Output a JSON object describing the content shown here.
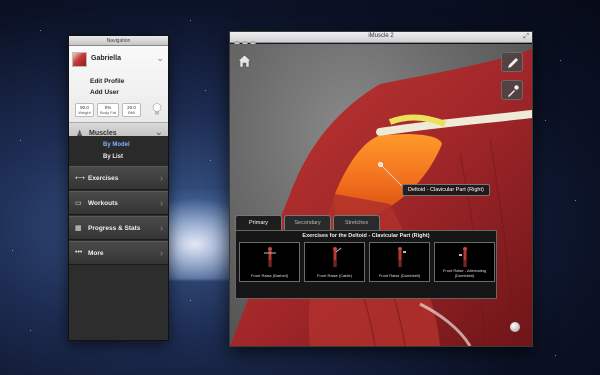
{
  "navigation": {
    "title": "Navigation",
    "user": {
      "name": "Gabriella",
      "edit_profile": "Edit Profile",
      "add_user": "Add User",
      "stats": [
        {
          "value": "90.0",
          "label": "Weight"
        },
        {
          "value": "0%",
          "label": "Body Fat"
        },
        {
          "value": "20.0",
          "label": "BMI"
        }
      ]
    },
    "muscles": {
      "label": "Muscles",
      "options": [
        "By Model",
        "By List"
      ],
      "selected": "By Model"
    },
    "menu": [
      {
        "label": "Exercises",
        "icon": "barbell-icon"
      },
      {
        "label": "Workouts",
        "icon": "tape-icon"
      },
      {
        "label": "Progress & Stats",
        "icon": "calendar-icon"
      },
      {
        "label": "More",
        "icon": "more-dots-icon"
      }
    ]
  },
  "window": {
    "title": "iMuscle 2",
    "callout": "Deltoid - Clavicular Part (Right)",
    "tabs": [
      "Primary",
      "Secondary",
      "Stretches"
    ],
    "active_tab": "Primary",
    "exercises_header": "Exercises for the Deltoid - Clavicular Part (Right)",
    "exercises": [
      {
        "name": "Front Raise (Barbell)"
      },
      {
        "name": "Front Raise (Cable)"
      },
      {
        "name": "Front Raise (Dumbbell)"
      },
      {
        "name": "Front Raise - Alternating (Dumbbell)"
      }
    ]
  },
  "colors": {
    "muscle_red": "#b8312c",
    "highlight_orange": "#f06a1c",
    "nav_dark": "#2d2d2d"
  }
}
